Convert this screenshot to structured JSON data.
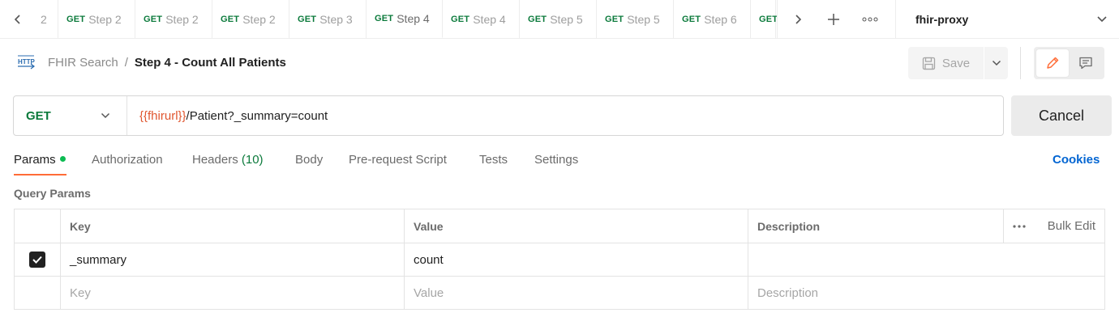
{
  "tabbar": {
    "tabs": [
      {
        "method": "",
        "name": "2"
      },
      {
        "method": "GET",
        "name": "Step 2"
      },
      {
        "method": "GET",
        "name": "Step 2"
      },
      {
        "method": "GET",
        "name": "Step 2"
      },
      {
        "method": "GET",
        "name": "Step 3"
      },
      {
        "method": "GET",
        "name": "Step 4"
      },
      {
        "method": "GET",
        "name": "Step 4"
      },
      {
        "method": "GET",
        "name": "Step 5"
      },
      {
        "method": "GET",
        "name": "Step 5"
      },
      {
        "method": "GET",
        "name": "Step 6"
      },
      {
        "method": "GET",
        "name": ""
      }
    ],
    "active_index": 5,
    "environment": "fhir-proxy"
  },
  "header": {
    "icon_text": "HTTP",
    "collection": "FHIR Search",
    "separator": "/",
    "request_name": "Step 4 - Count All Patients",
    "save_label": "Save"
  },
  "url_bar": {
    "method": "GET",
    "url_variable": "{{fhirurl}}",
    "url_rest": "/Patient?_summary=count",
    "cancel_label": "Cancel"
  },
  "request_tabs": {
    "params": "Params",
    "authorization": "Authorization",
    "headers": "Headers",
    "headers_count": "(10)",
    "body": "Body",
    "prerequest": "Pre-request Script",
    "tests": "Tests",
    "settings": "Settings",
    "cookies": "Cookies"
  },
  "query_params": {
    "title": "Query Params",
    "columns": {
      "key": "Key",
      "value": "Value",
      "description": "Description",
      "bulk_edit": "Bulk Edit"
    },
    "rows": [
      {
        "checked": true,
        "key": "_summary",
        "value": "count",
        "description": ""
      }
    ],
    "placeholder": {
      "key": "Key",
      "value": "Value",
      "description": "Description"
    }
  },
  "colors": {
    "method_get": "#0b7a3b",
    "accent": "#ff6c37",
    "link": "#0265d2",
    "variable": "#e0562f"
  }
}
